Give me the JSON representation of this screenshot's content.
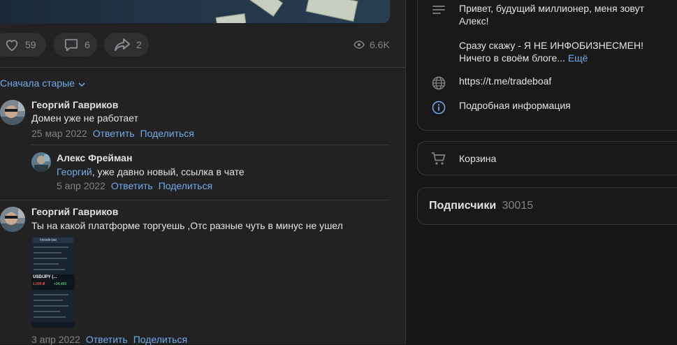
{
  "post": {
    "likes": "59",
    "comments": "6",
    "shares": "2",
    "views": "6.6K"
  },
  "comments_section": {
    "sort_label": "Сначала старые",
    "items": [
      {
        "author": "Георгий Гавриков",
        "text": "Домен уже не работает",
        "date": "25 мар 2022",
        "reply": "Ответить",
        "share": "Поделиться"
      },
      {
        "author": "Алекс Фрейман",
        "mention": "Георгий",
        "text": ", уже давно новый, ссылка в чате",
        "date": "5 апр 2022",
        "reply": "Ответить",
        "share": "Поделиться"
      },
      {
        "author": "Георгий Гавриков",
        "text": "Ты на какой платформе торгуешь ,Отс разные чуть в минус не ушел",
        "date": "3 апр 2022",
        "reply": "Ответить",
        "share": "Поделиться",
        "attachment": {
          "title": "Intrade.bar",
          "pair": "USD/JPY (...",
          "amount": "1,000 ₽",
          "profit": "+34,400"
        }
      }
    ]
  },
  "sidebar": {
    "description_line1": "Привет, будущий миллионер, меня зовут",
    "description_line2": "Алекс!",
    "description_line3": "Сразу скажу - Я НЕ ИНФОБИЗНЕСМЕН!",
    "description_line4": "Ничего в своём блоге...",
    "more_link": "Ещё",
    "link": "https://t.me/tradeboaf",
    "details_link": "Подробная информация",
    "cart_label": "Корзина",
    "subscribers_label": "Подписчики",
    "subscribers_count": "30015"
  },
  "colors": {
    "accent": "#71aaeb",
    "panel": "#222222",
    "background": "#161616",
    "muted": "#828282"
  }
}
